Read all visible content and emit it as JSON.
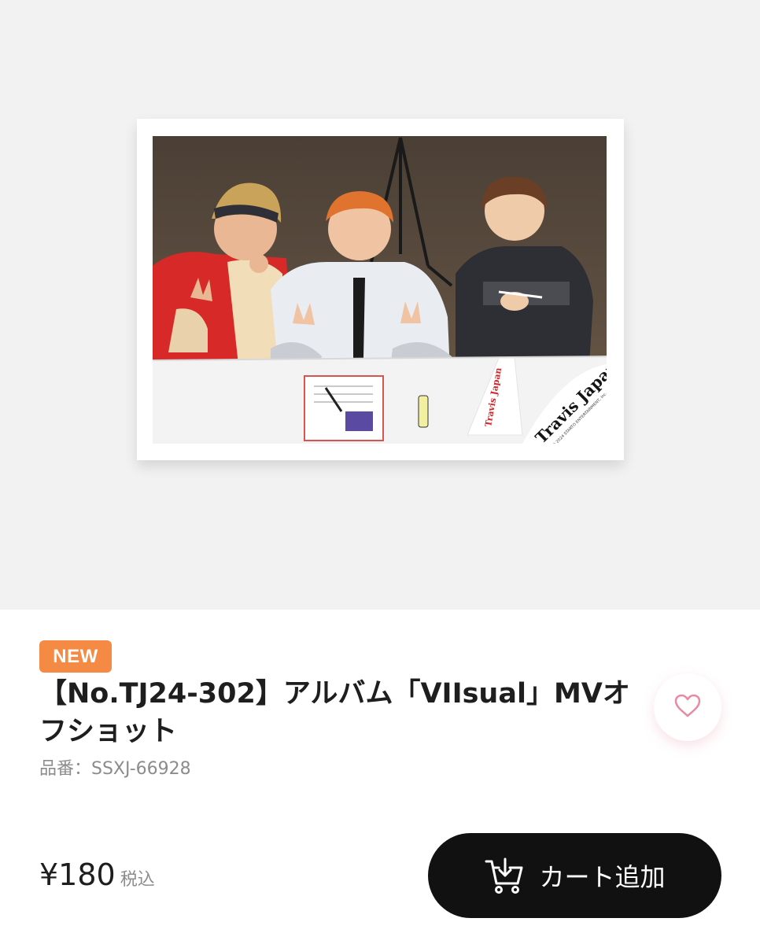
{
  "product": {
    "badge": "NEW",
    "title": "【No.TJ24-302】アルバム「VIIsual」MVオフショット",
    "sku": "品番：SSXJ-66928",
    "image": {
      "logo_text": "Travis Japan",
      "copyright": "© 2024 STARTO ENTERTAINMENT, Inc."
    }
  },
  "price": {
    "value": "¥180",
    "tax_label": "税込"
  },
  "actions": {
    "favorite_icon": "heart-outline-icon",
    "cart_icon": "cart-download-icon",
    "cart_label": "カート追加"
  },
  "colors": {
    "badge": "#f58a45",
    "cart_button": "#111111",
    "heart": "#e98aa3",
    "hero_background": "#f2f2f2"
  }
}
